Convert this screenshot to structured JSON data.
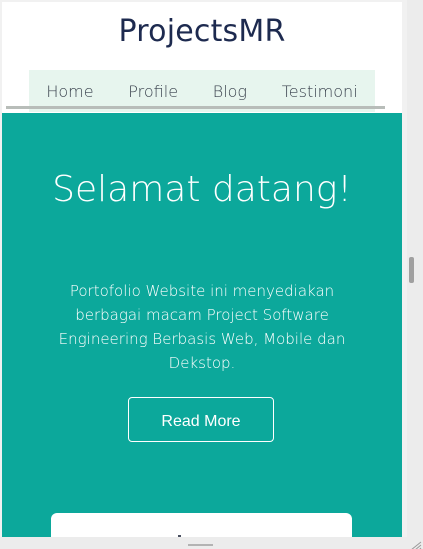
{
  "brand": "ProjectsMR",
  "nav": {
    "items": [
      {
        "label": "Home"
      },
      {
        "label": "Profile"
      },
      {
        "label": "Blog"
      },
      {
        "label": "Testimoni"
      }
    ]
  },
  "hero": {
    "title": "Selamat datang!",
    "description": "Portofolio Website ini menyediakan berbagai macam Project Software Engineering Berbasis Web, Mobile dan Dekstop.",
    "button_label": "Read More"
  },
  "colors": {
    "hero_background": "#0ca89b",
    "nav_background": "#e7f5ee",
    "brand_text": "#1d2a4f",
    "text_light": "#ffffff"
  },
  "icons": {
    "resize_grip": "resize-grip-icon"
  }
}
